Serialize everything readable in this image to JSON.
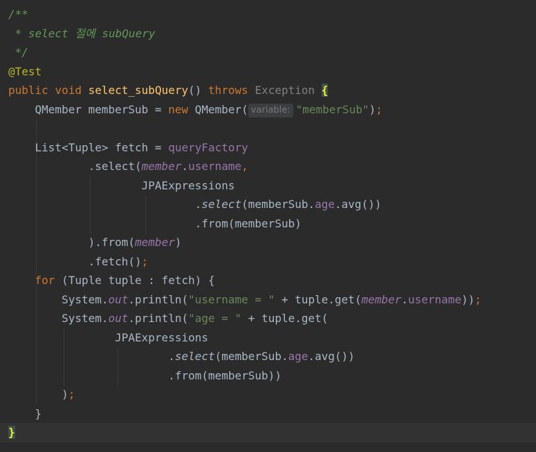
{
  "theme": {
    "background": "#2b2b2b",
    "current_line": "#323232",
    "text": "#a9b7c6",
    "keyword": "#cc7832",
    "method": "#ffc66d",
    "string": "#6a8759",
    "field": "#9876aa",
    "comment": "#629755",
    "annotation": "#bbb529",
    "brace_match": "#ffef28"
  },
  "code": {
    "l1": {
      "c": "/**"
    },
    "l2": {
      "c": " * select 절에 subQuery"
    },
    "l3": {
      "c": " */"
    },
    "l4": {
      "a": "@Test"
    },
    "l5": {
      "kw1": "public",
      "kw2": "void",
      "fn": "select_subQuery",
      "p": "()",
      "kw3": "throws",
      "exc": "Exception",
      "brace": "{"
    },
    "l6": {
      "t1": "    QMember memberSub = ",
      "kw": "new",
      "t2": "QMember(",
      "hint": "variable:",
      "str": "\"memberSub\"",
      "t3": ")",
      "semi": ";"
    },
    "l8": {
      "t1": "    List<Tuple> fetch = ",
      "fld": "queryFactory"
    },
    "l9": {
      "t1": "            .select(",
      "f1": "member",
      "t2": ".",
      "f2": "username",
      "comma": ","
    },
    "l10": {
      "t1": "                    JPAExpressions"
    },
    "l11": {
      "t1": "                            .",
      "m": "select",
      "t2": "(memberSub.",
      "f": "age",
      "t3": ".avg())"
    },
    "l12": {
      "t1": "                            .from(memberSub)"
    },
    "l13": {
      "t1": "            ).from(",
      "f": "member",
      "t2": ")"
    },
    "l14": {
      "t1": "            .fetch()",
      "semi": ";"
    },
    "l15": {
      "pad": "    ",
      "kw": "for",
      "t1": " (Tuple tuple : fetch) {"
    },
    "l16": {
      "t1": "        System.",
      "out": "out",
      "t2": ".println(",
      "str": "\"username = \"",
      "t3": " + tuple.get(",
      "f1": "member",
      "t4": ".",
      "f2": "username",
      "t5": "))",
      "semi": ";"
    },
    "l17": {
      "t1": "        System.",
      "out": "out",
      "t2": ".println(",
      "str": "\"age = \"",
      "t3": " + tuple.get("
    },
    "l18": {
      "t1": "                JPAExpressions"
    },
    "l19": {
      "t1": "                        .",
      "m": "select",
      "t2": "(memberSub.",
      "f": "age",
      "t3": ".avg())"
    },
    "l20": {
      "t1": "                        .from(memberSub))"
    },
    "l21": {
      "t1": "        )",
      "semi": ";"
    },
    "l22": {
      "t1": "    }"
    },
    "l23": {
      "brace": "}"
    }
  }
}
